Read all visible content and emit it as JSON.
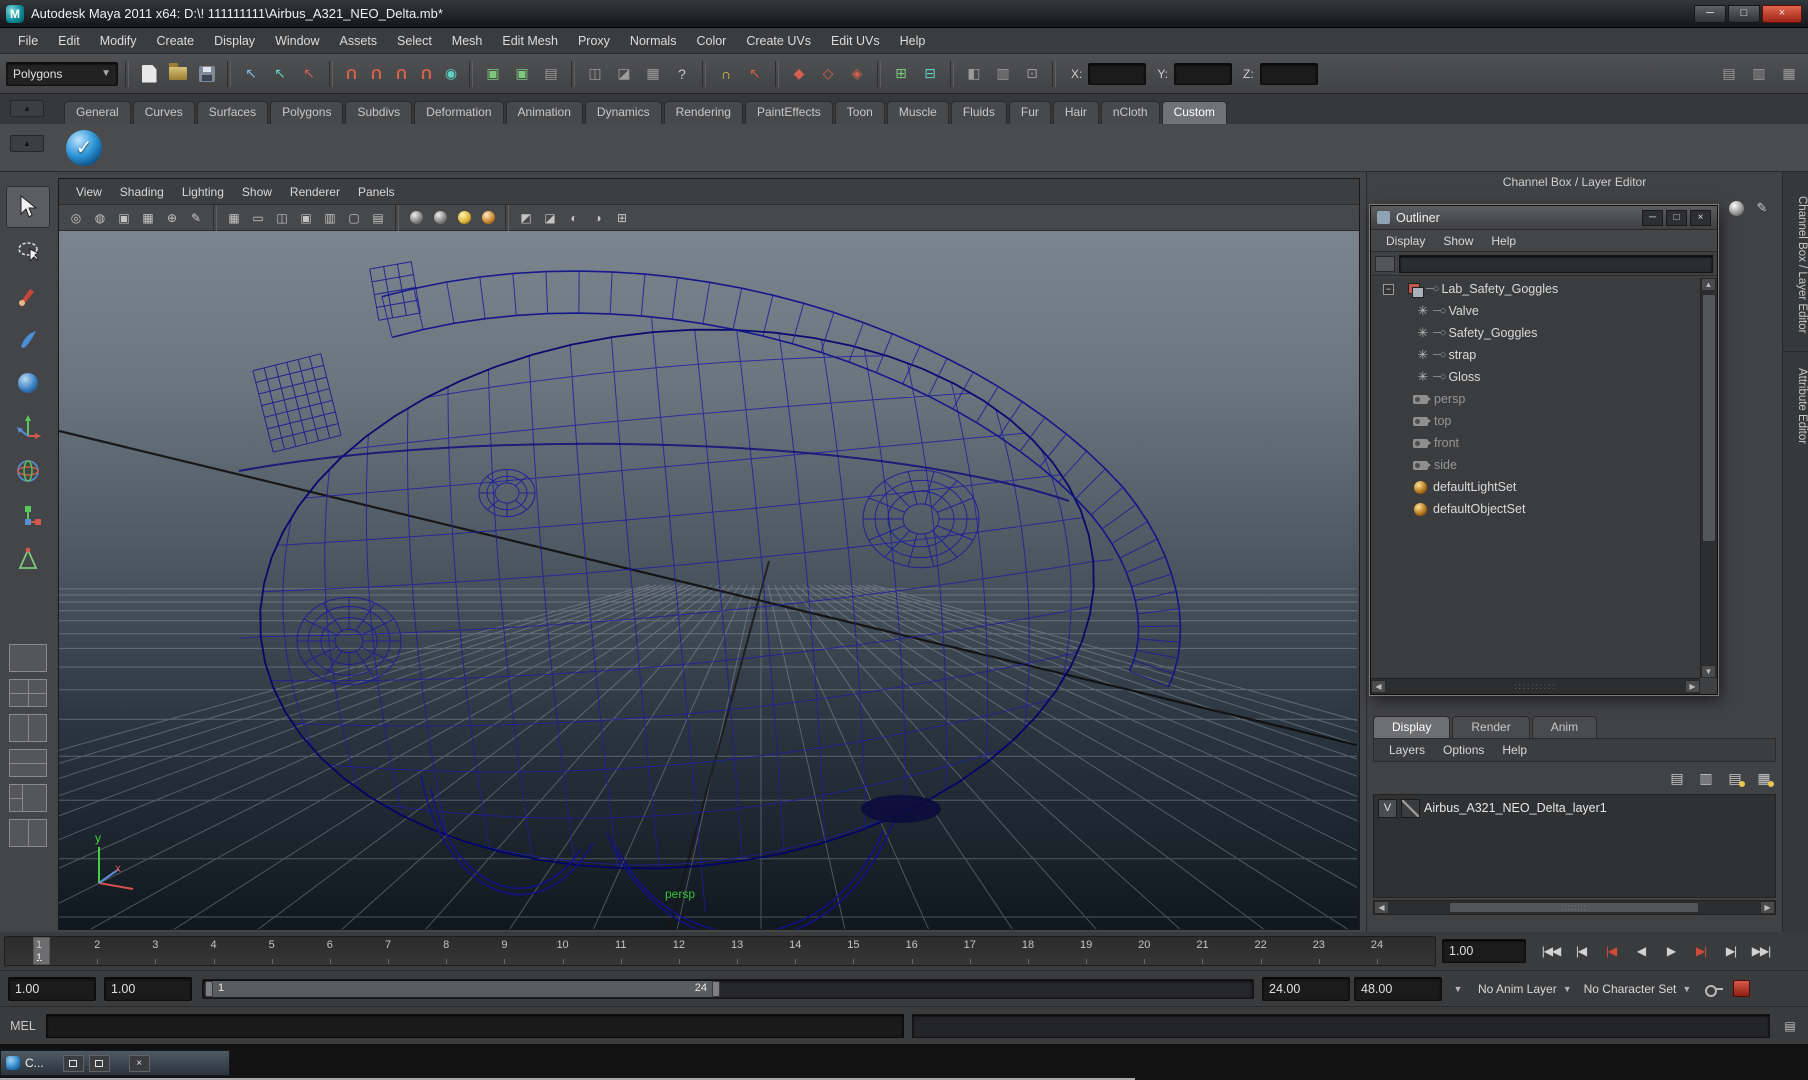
{
  "window": {
    "title": "Autodesk Maya 2011 x64: D:\\! 111111111\\Airbus_A321_NEO_Delta.mb*",
    "logo_letter": "M",
    "buttons": {
      "minimize": "─",
      "maximize": "□",
      "close": "×"
    }
  },
  "menubar": {
    "items": [
      "File",
      "Edit",
      "Modify",
      "Create",
      "Display",
      "Window",
      "Assets",
      "Select",
      "Mesh",
      "Edit Mesh",
      "Proxy",
      "Normals",
      "Color",
      "Create UVs",
      "Edit UVs",
      "Help"
    ]
  },
  "toolbar": {
    "mode": "Polygons",
    "x_label": "X:",
    "y_label": "Y:",
    "z_label": "Z:",
    "x_value": "",
    "y_value": "",
    "z_value": ""
  },
  "shelf": {
    "tabs": [
      "General",
      "Curves",
      "Surfaces",
      "Polygons",
      "Subdivs",
      "Deformation",
      "Animation",
      "Dynamics",
      "Rendering",
      "PaintEffects",
      "Toon",
      "Muscle",
      "Fluids",
      "Fur",
      "Hair",
      "nCloth",
      "Custom"
    ],
    "active": "Custom",
    "custom_tool_glyph": "✓"
  },
  "viewport": {
    "menus": [
      "View",
      "Shading",
      "Lighting",
      "Show",
      "Renderer",
      "Panels"
    ],
    "camera_label": "persp",
    "axis_x": "x",
    "axis_y": "y"
  },
  "right_dock": {
    "channel_box_label": "Channel Box / Layer Editor",
    "attribute_editor_label": "Attribute Editor"
  },
  "outliner": {
    "title": "Outliner",
    "menus": [
      "Display",
      "Show",
      "Help"
    ],
    "filter_value": "",
    "items": [
      {
        "label": "Lab_Safety_Goggles",
        "type": "group",
        "expanded": true
      },
      {
        "label": "Valve",
        "type": "mesh"
      },
      {
        "label": "Safety_Goggles",
        "type": "mesh"
      },
      {
        "label": "strap",
        "type": "mesh"
      },
      {
        "label": "Gloss",
        "type": "mesh"
      },
      {
        "label": "persp",
        "type": "camera",
        "muted": true
      },
      {
        "label": "top",
        "type": "camera",
        "muted": true
      },
      {
        "label": "front",
        "type": "camera",
        "muted": true
      },
      {
        "label": "side",
        "type": "camera",
        "muted": true
      },
      {
        "label": "defaultLightSet",
        "type": "set"
      },
      {
        "label": "defaultObjectSet",
        "type": "set"
      }
    ]
  },
  "layer_editor": {
    "tabs": [
      "Display",
      "Render",
      "Anim"
    ],
    "active_tab": "Display",
    "menus": [
      "Layers",
      "Options",
      "Help"
    ],
    "layers": [
      {
        "visibility": "V",
        "name": "Airbus_A321_NEO_Delta_layer1"
      }
    ]
  },
  "timeline": {
    "frames": [
      1,
      2,
      3,
      4,
      5,
      6,
      7,
      8,
      9,
      10,
      11,
      12,
      13,
      14,
      15,
      16,
      17,
      18,
      19,
      20,
      21,
      22,
      23,
      24
    ],
    "current_frame": "1",
    "current_time": "1.00",
    "playback": {
      "go_to_start": "|◀◀",
      "step_back_frame": "|◀",
      "step_back_key": "|◀",
      "play_backwards": "◀",
      "play_forwards": "▶",
      "step_forward_key": "▶|",
      "step_forward_frame": "▶|",
      "go_to_end": "▶▶|"
    }
  },
  "range_slider": {
    "animation_start": "1.00",
    "playback_start": "1.00",
    "range_start_label": "1",
    "range_end_label": "24",
    "playback_end": "24.00",
    "animation_end": "48.00",
    "anim_layer": "No Anim Layer",
    "character_set": "No Character Set"
  },
  "command_line": {
    "label": "MEL",
    "input_value": ""
  },
  "taskbar": {
    "window_label": "C..."
  }
}
